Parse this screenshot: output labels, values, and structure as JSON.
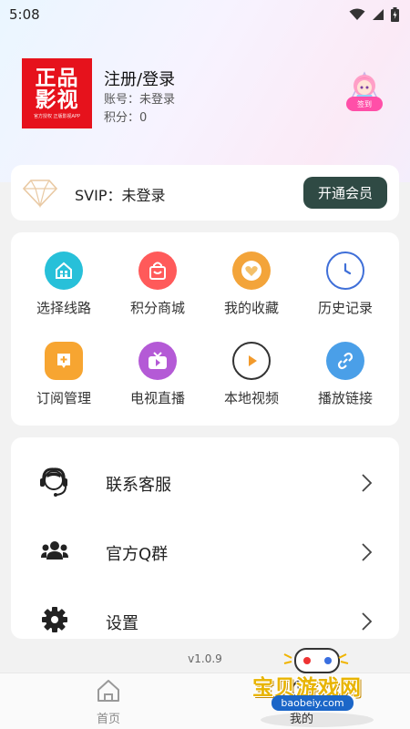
{
  "status_bar": {
    "time": "5:08",
    "icons": [
      "wifi-icon",
      "signal-icon",
      "battery-charging-icon"
    ]
  },
  "profile": {
    "logo_line1": "正品",
    "logo_line2": "影视",
    "logo_tagline": "官方授权 正版影视APP",
    "title": "注册/登录",
    "account": "账号：未登录",
    "points": "积分：0",
    "checkin_label": "签到"
  },
  "svip": {
    "icon": "diamond-icon",
    "status": "SVIP：未登录",
    "button_label": "开通会员"
  },
  "grid": {
    "items": [
      {
        "label": "选择线路",
        "icon": "route-icon",
        "color": "#27c0d9"
      },
      {
        "label": "积分商城",
        "icon": "shopping-bag-icon",
        "color": "#ff5a5a"
      },
      {
        "label": "我的收藏",
        "icon": "heart-icon",
        "color": "#f3a43a"
      },
      {
        "label": "历史记录",
        "icon": "clock-icon",
        "color": "#3f6fd8"
      },
      {
        "label": "订阅管理",
        "icon": "subscribe-icon",
        "color": "#f7a531"
      },
      {
        "label": "电视直播",
        "icon": "tv-icon",
        "color": "#b45ad6"
      },
      {
        "label": "本地视频",
        "icon": "play-circle-icon",
        "color": "#f29a2c"
      },
      {
        "label": "播放链接",
        "icon": "link-icon",
        "color": "#4a9fe8"
      }
    ]
  },
  "menu": {
    "items": [
      {
        "label": "联系客服",
        "icon": "headset-icon"
      },
      {
        "label": "官方Q群",
        "icon": "group-icon"
      },
      {
        "label": "设置",
        "icon": "gear-icon"
      }
    ]
  },
  "version": "v1.0.9",
  "tabbar": {
    "home_label": "首页",
    "mine_label": "我的"
  },
  "watermark": {
    "title": "宝贝游戏网",
    "url": "baobeiy.com"
  }
}
